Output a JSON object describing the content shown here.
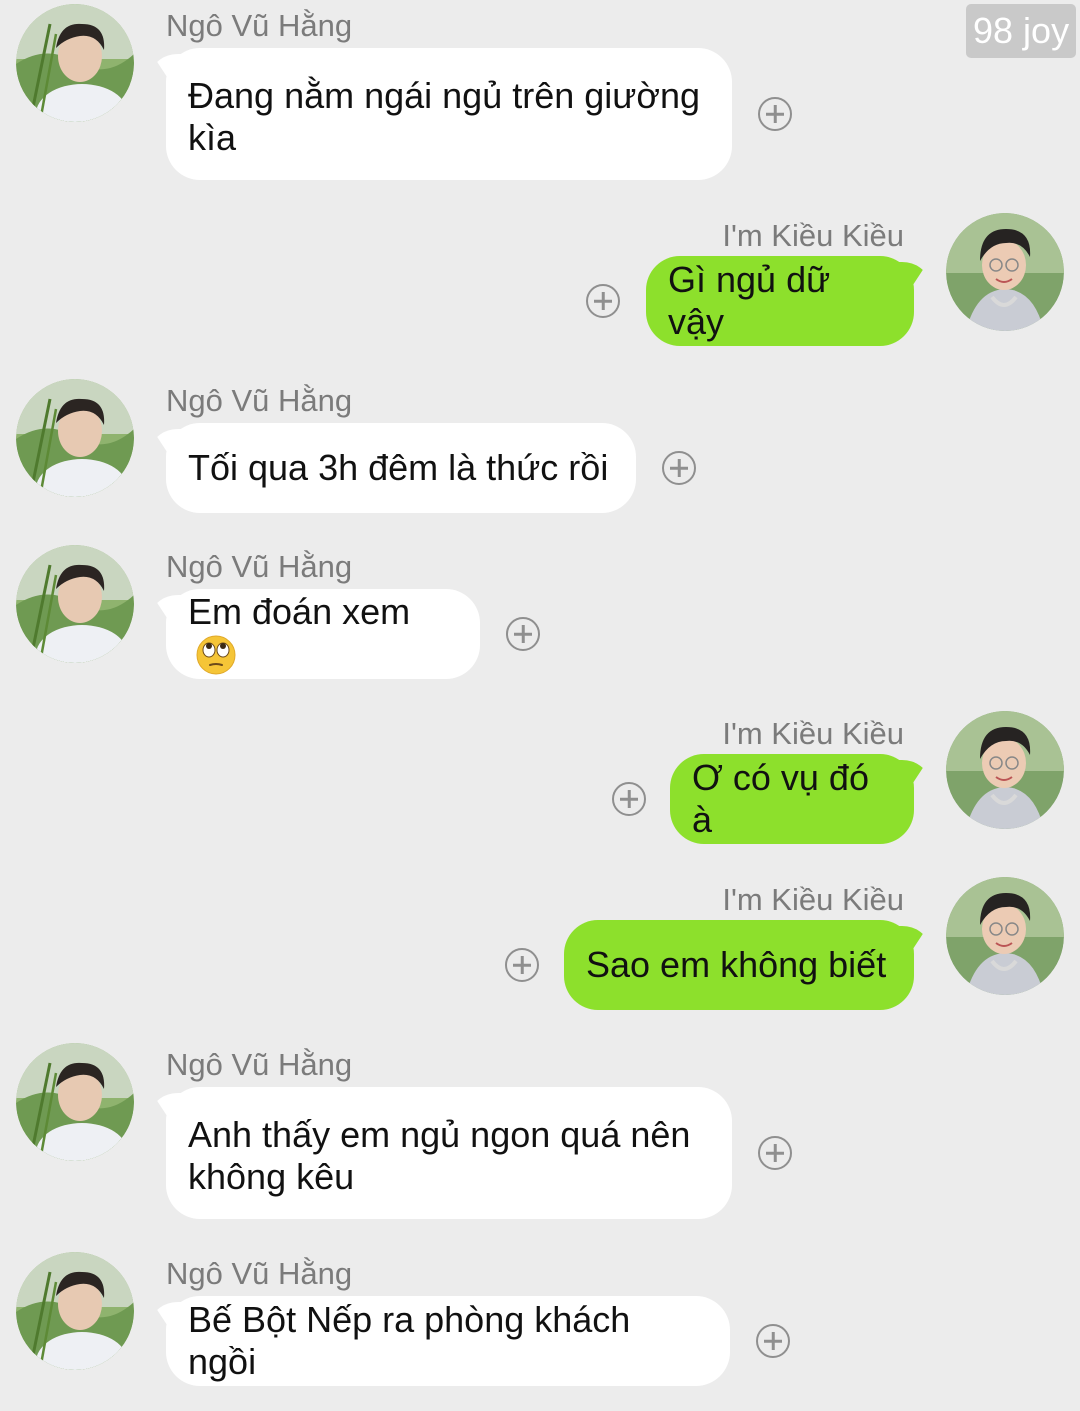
{
  "watermark": "98 joy",
  "colors": {
    "background": "#ececec",
    "incoming_bubble": "#ffffff",
    "outgoing_bubble": "#8de02c",
    "sender_name": "#7b7b7b"
  },
  "messages": [
    {
      "sender": "Ngô Vũ Hằng",
      "side": "left",
      "avatar": "avatar-ngo-vu-hang",
      "lines": [
        "Đang nằm ngái ngủ trên giường",
        "kìa"
      ]
    },
    {
      "sender": "I'm Kiều Kiều",
      "side": "right",
      "avatar": "avatar-kieu-kieu",
      "lines": [
        "Gì ngủ dữ vậy"
      ]
    },
    {
      "sender": "Ngô Vũ Hằng",
      "side": "left",
      "avatar": "avatar-ngo-vu-hang",
      "lines": [
        "Tối qua 3h đêm là thức rồi"
      ]
    },
    {
      "sender": "Ngô Vũ Hằng",
      "side": "left",
      "avatar": "avatar-ngo-vu-hang",
      "lines": [
        "Em đoán xem"
      ],
      "emoji": "face-with-rolling-eyes-icon"
    },
    {
      "sender": "I'm Kiều Kiều",
      "side": "right",
      "avatar": "avatar-kieu-kieu",
      "lines": [
        "Ơ có vụ đó à"
      ]
    },
    {
      "sender": "I'm Kiều Kiều",
      "side": "right",
      "avatar": "avatar-kieu-kieu",
      "lines": [
        "Sao em không biết"
      ]
    },
    {
      "sender": "Ngô Vũ Hằng",
      "side": "left",
      "avatar": "avatar-ngo-vu-hang",
      "lines": [
        "Anh thấy em ngủ ngon quá nên",
        "không kêu"
      ]
    },
    {
      "sender": "Ngô Vũ Hằng",
      "side": "left",
      "avatar": "avatar-ngo-vu-hang",
      "lines": [
        "Bế Bột Nếp ra phòng khách ngồi"
      ]
    }
  ],
  "icons": {
    "reaction": "add-reaction-icon"
  }
}
